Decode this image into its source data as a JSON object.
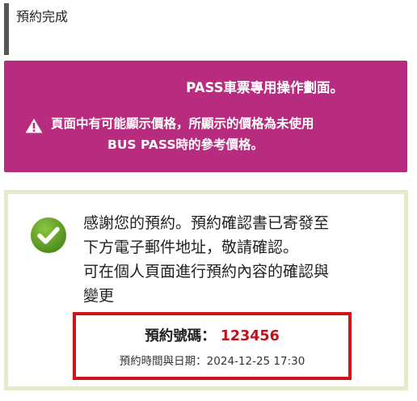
{
  "header": {
    "title": "預約完成"
  },
  "notice": {
    "heading": "PASS車票專用操作劃面。",
    "warning_lines": [
      "頁面中有可能顯示價格，所顯示的價格為未使用",
      "BUS PASS時的參考價格。"
    ],
    "background_color": "#b82c7f",
    "icon": "warning-triangle-icon"
  },
  "confirmation": {
    "icon": "check-circle-icon",
    "message_lines": [
      "感謝您的預約。預約確認書已寄發至",
      "下方電子郵件地址，敬請確認。",
      "可在個人頁面進行預約內容的確認與",
      "變更"
    ],
    "reservation": {
      "number_label": "預約號碼：",
      "number_value": "123456",
      "datetime_label": "預約時間與日期：",
      "datetime_value": "2024-12-25 17:30"
    },
    "border_color": "#e2ecc9",
    "highlight_color": "#d0121b"
  }
}
